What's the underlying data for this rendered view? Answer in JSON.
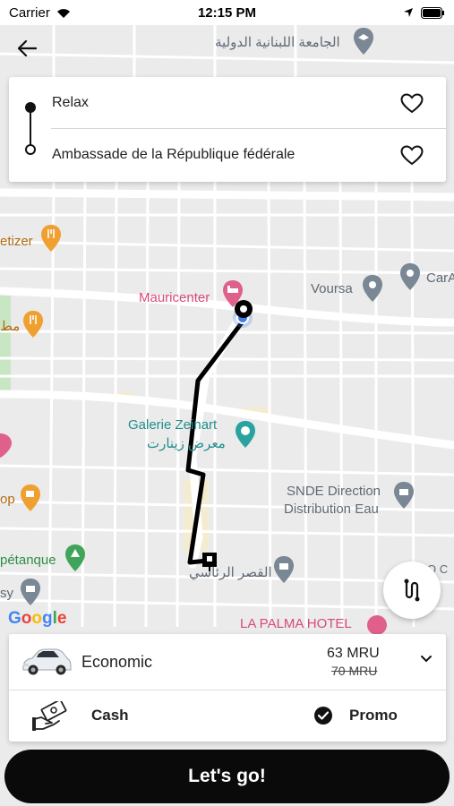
{
  "status_bar": {
    "carrier": "Carrier",
    "time": "12:15 PM"
  },
  "route": {
    "origin": "Relax",
    "destination": "Ambassade de la République fédérale"
  },
  "map": {
    "poi": {
      "university": "الجامعة اللبنانية الدولية",
      "mauricenter": "Mauricenter",
      "voursa": "Voursa",
      "cara": "CarA",
      "galerie_line1": "Galerie Zeinart",
      "galerie_line2": "معرض زينارت",
      "snde_line1": "SNDE Direction",
      "snde_line2": "Distribution Eau",
      "palace": "القصر الرئاسي",
      "la_palma": "LA PALMA HOTEL",
      "petizer": "etizer",
      "mat": "مط",
      "op": "op",
      "petanque": "pétanque",
      "sy": "sy",
      "oc": "O C"
    },
    "google": "Google"
  },
  "ride": {
    "name": "Economic",
    "price": "63 MRU",
    "old_price": "70 MRU"
  },
  "payment": {
    "cash_label": "Cash",
    "promo_label": "Promo"
  },
  "go_button": "Let's go!",
  "colors": {
    "accent": "#0a0a0a",
    "route_line": "#000000",
    "poi_pink": "#d64a7d",
    "poi_teal": "#1f8f8c",
    "poi_orange": "#f0a030",
    "poi_gray": "#7a8794",
    "location_blue": "#3b7ded"
  }
}
